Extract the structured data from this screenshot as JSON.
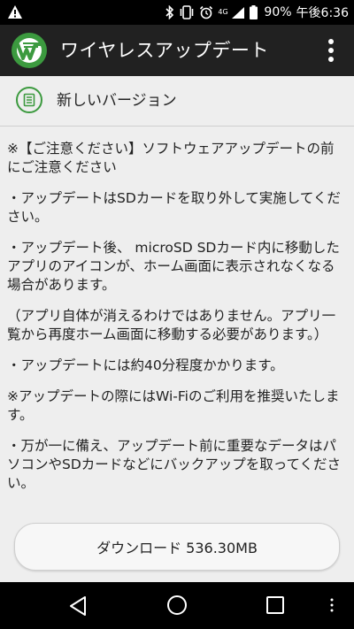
{
  "status_bar": {
    "network_type": "4G",
    "battery": "90%",
    "time": "午後6:36"
  },
  "app_bar": {
    "title": "ワイヤレスアップデート"
  },
  "section": {
    "title": "新しいバージョン"
  },
  "notes": [
    "※【ご注意ください】ソフトウェアアップデートの前にご注意ください",
    "・アップデートはSDカードを取り外して実施してください。",
    "・アップデート後、 microSD SDカード内に移動したアプリのアイコンが、ホーム画面に表示されなくなる場合があります。",
    "（アプリ自体が消えるわけではありません。アプリ一覧から再度ホーム画面に移動する必要があります。）",
    "・アップデートには約40分程度かかります。",
    "※アップデートの際にはWi-Fiのご利用を推奨いたします。",
    "・万が一に備え、アップデート前に重要なデータはパソコンやSDカードなどにバックアップを取ってください。"
  ],
  "download_button": {
    "label": "ダウンロード 536.30MB"
  },
  "icons": {
    "warning": "warning-icon",
    "bluetooth": "bluetooth-icon",
    "vibrate": "vibrate-icon",
    "alarm": "alarm-icon",
    "signal": "signal-icon",
    "battery": "battery-icon",
    "app_logo": "wireless-update-logo",
    "version": "document-icon",
    "back": "back-icon",
    "home": "home-icon",
    "recent": "recent-apps-icon",
    "menu": "menu-icon"
  },
  "colors": {
    "accent": "#3c9a3f",
    "app_bar": "#212121",
    "content_bg": "#eeeeee"
  }
}
